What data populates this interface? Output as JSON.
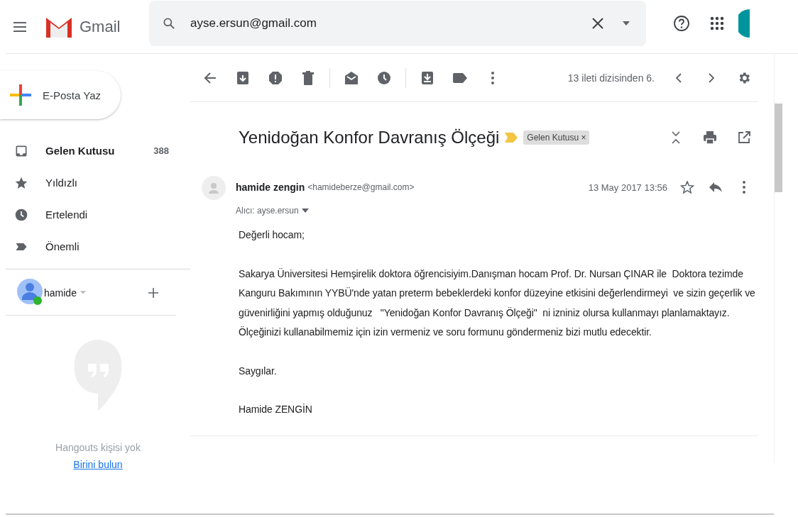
{
  "header": {
    "app_name": "Gmail",
    "search": {
      "value": "ayse.ersun@gmail.com"
    }
  },
  "compose": {
    "label": "E-Posta Yaz"
  },
  "nav": [
    {
      "kind": "inbox",
      "label": "Gelen Kutusu",
      "count": "388",
      "selected": true
    },
    {
      "kind": "star",
      "label": "Yıldızlı",
      "selected": false
    },
    {
      "kind": "clock",
      "label": "Ertelendi",
      "selected": false
    },
    {
      "kind": "important",
      "label": "Önemli",
      "selected": false
    }
  ],
  "hangouts": {
    "user": "hamide",
    "online": true,
    "empty_text": "Hangouts kişisi yok",
    "link": "Birini bulun"
  },
  "toolbar": {
    "counter": "13 ileti dizisinden 6."
  },
  "message": {
    "subject": "Yenidoğan Konfor Davranış Ölçeği",
    "important": true,
    "label": {
      "text": "Gelen Kutusu",
      "close": "×"
    },
    "sender_name": "hamide zengin",
    "sender_email": "<hamideberze@gmail.com>",
    "date": "13 May 2017 13:56",
    "recipient": "Alıcı: ayse.ersun",
    "body": [
      "Değerli hocam;",
      "Sakarya Üniversitesi Hemşirelik doktora öğrencisiyim.Danışman hocam Prof. Dr. Nursan ÇINAR ile  Doktora tezimde Kanguru Bakımının YYBÜ'nde yatan preterm bebeklerdeki konfor düzeyine etkisini değerlendirmeyi  ve sizin geçerlik ve güvenirliğini yapmış olduğunuz   \"Yenidoğan Konfor Davranış Ölçeği\"  ni izniniz olursa kullanmayı planlamaktayız. Ölçeğinizi kullanabilmemiz için izin vermeniz ve soru formunu göndermeniz bizi mutlu edecektir.",
      "Saygılar.",
      "Hamide ZENGİN"
    ]
  }
}
